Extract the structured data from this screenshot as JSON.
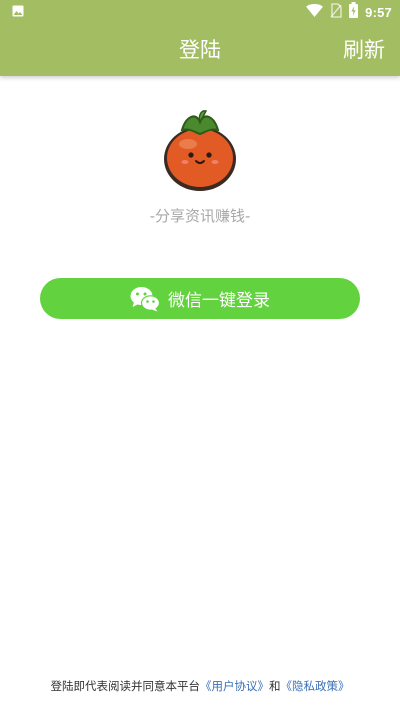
{
  "status_bar": {
    "time": "9:57",
    "icons": [
      "image-icon",
      "wifi-icon",
      "no-sim-icon",
      "battery-charging-icon"
    ]
  },
  "app_bar": {
    "title": "登陆",
    "refresh_label": "刷新",
    "color": "#a3bd63"
  },
  "main": {
    "logo_icon": "persimmon-mascot-icon",
    "slogan": "-分享资讯赚钱-",
    "wechat_login_label": "微信一键登录",
    "wechat_icon": "wechat-icon",
    "button_color": "#62d33e"
  },
  "footer": {
    "prefix": "登陆即代表阅读并同意本平台",
    "user_agreement": "《用户协议》",
    "conjunction": "和",
    "privacy_policy": "《隐私政策》"
  }
}
